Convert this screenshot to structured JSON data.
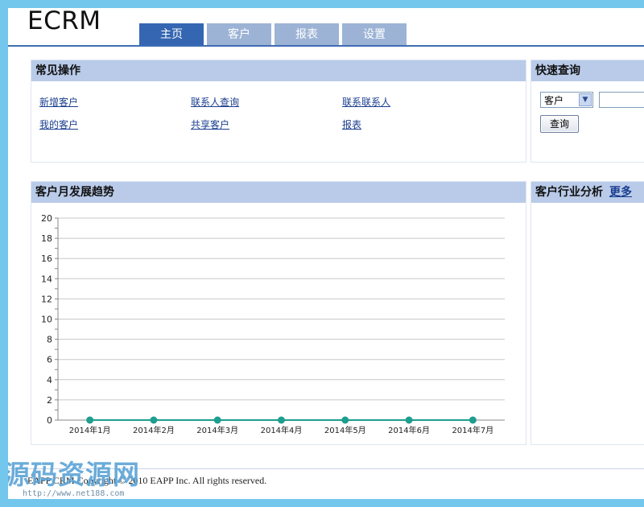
{
  "brand": "ECRM",
  "tabs": [
    {
      "label": "主页",
      "active": true
    },
    {
      "label": "客户",
      "active": false
    },
    {
      "label": "报表",
      "active": false
    },
    {
      "label": "设置",
      "active": false
    }
  ],
  "common_ops": {
    "title": "常见操作",
    "links": [
      "新增客户",
      "联系人查询",
      "联系联系人",
      "我的客户",
      "共享客户",
      "报表"
    ]
  },
  "quick_search": {
    "title": "快速查询",
    "select_value": "客户",
    "input_value": "",
    "button_label": "查询"
  },
  "trend": {
    "title": "客户月发展趋势"
  },
  "industry": {
    "title": "客户行业分析",
    "more_link": "更多"
  },
  "chart_data": {
    "type": "line",
    "categories": [
      "2014年1月",
      "2014年2月",
      "2014年3月",
      "2014年4月",
      "2014年5月",
      "2014年6月",
      "2014年7月"
    ],
    "values": [
      0,
      0,
      0,
      0,
      0,
      0,
      0
    ],
    "ylim": [
      0,
      20
    ],
    "yticks": [
      0,
      2,
      4,
      6,
      8,
      10,
      12,
      14,
      16,
      18,
      20
    ],
    "title": "",
    "xlabel": "",
    "ylabel": "",
    "grid": true,
    "color": "#1e9e8e"
  },
  "footer": "EAPP CRM Copyright © 2010 EAPP Inc. All rights reserved.",
  "watermark": {
    "text": "源码资源网",
    "url": "http://www.net188.com"
  }
}
